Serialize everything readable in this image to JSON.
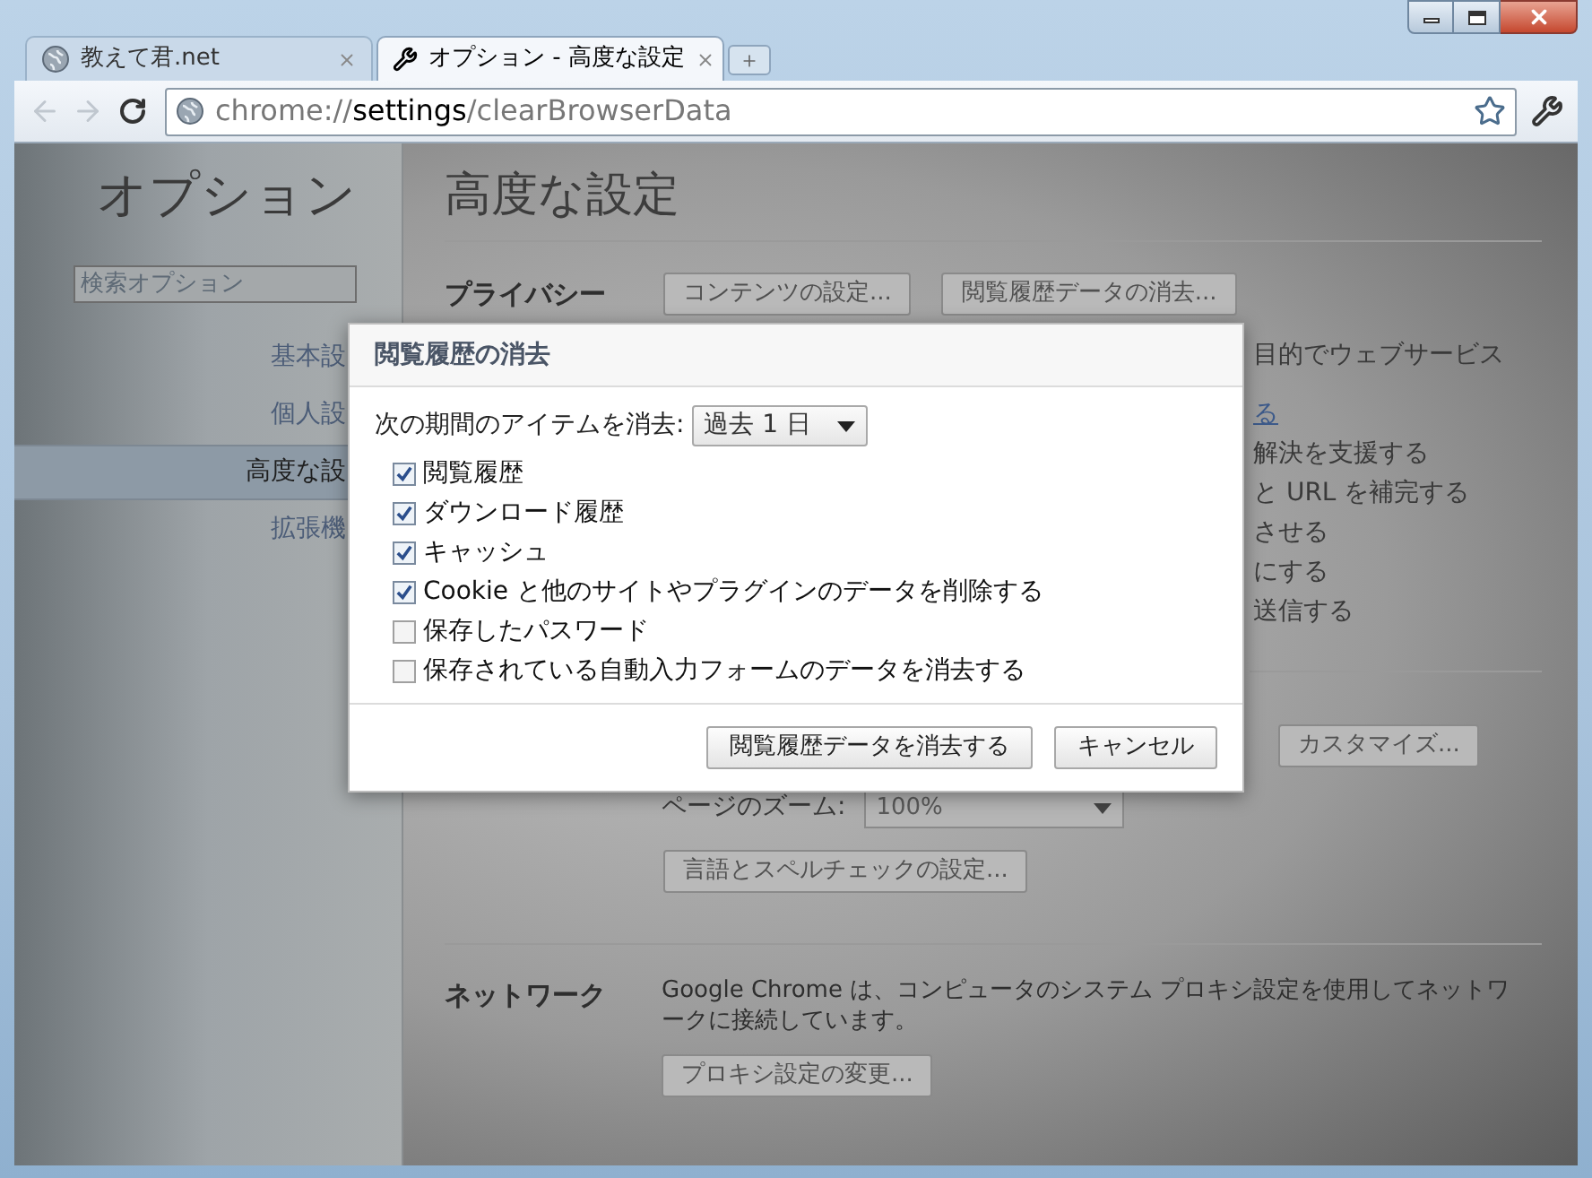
{
  "tabs": [
    {
      "title": "教えて君.net",
      "kind": "web",
      "selected": false
    },
    {
      "title": "オプション - 高度な設定",
      "kind": "settings",
      "selected": true
    }
  ],
  "toolbar": {
    "back": {
      "disabled": true
    },
    "forward": {
      "disabled": true
    },
    "address": {
      "scheme": "chrome://",
      "host": "settings",
      "path": "/clearBrowserData"
    }
  },
  "sidebar": {
    "title": "オプション",
    "search": {
      "placeholder": "検索オプション"
    },
    "items": [
      {
        "label": "基本設",
        "selected": false
      },
      {
        "label": "個人設",
        "selected": false
      },
      {
        "label": "高度な設",
        "selected": true
      },
      {
        "label": "拡張機",
        "selected": false
      }
    ]
  },
  "page": {
    "title": "高度な設定",
    "privacy": {
      "heading": "プライバシー",
      "buttons": [
        "コンテンツの設定...",
        "閲覧履歴データの消去..."
      ],
      "lines": [
        {
          "text": "目的でウェブサービス",
          "kind": "text"
        },
        {
          "text": "る",
          "kind": "link"
        },
        {
          "text": "解決を支援する",
          "kind": "text"
        },
        {
          "text": "と URL を補完する",
          "kind": "text"
        },
        {
          "text": "させる",
          "kind": "text"
        },
        {
          "text": "にする",
          "kind": "text"
        },
        {
          "text": "送信する",
          "kind": "text"
        }
      ]
    },
    "web_content": {
      "customize_button": "カスタマイズ...",
      "zoom_label": "ページのズーム:",
      "zoom_value": "100%",
      "language_button": "言語とスペルチェックの設定..."
    },
    "network": {
      "heading": "ネットワーク",
      "description": "Google Chrome は、コンピュータのシステム プロキシ設定を使用してネットワークに接続しています。",
      "button": "プロキシ設定の変更..."
    }
  },
  "dialog": {
    "title": "閲覧履歴の消去",
    "period_label": "次の期間のアイテムを消去:",
    "period_value": "過去 1 日",
    "options": [
      {
        "label": "閲覧履歴",
        "checked": true
      },
      {
        "label": "ダウンロード履歴",
        "checked": true
      },
      {
        "label": "キャッシュ",
        "checked": true
      },
      {
        "label": "Cookie と他のサイトやプラグインのデータを削除する",
        "checked": true
      },
      {
        "label": "保存したパスワード",
        "checked": false
      },
      {
        "label": "保存されている自動入力フォームのデータを消去する",
        "checked": false
      }
    ],
    "buttons": [
      "閲覧履歴データを消去する",
      "キャンセル"
    ]
  }
}
